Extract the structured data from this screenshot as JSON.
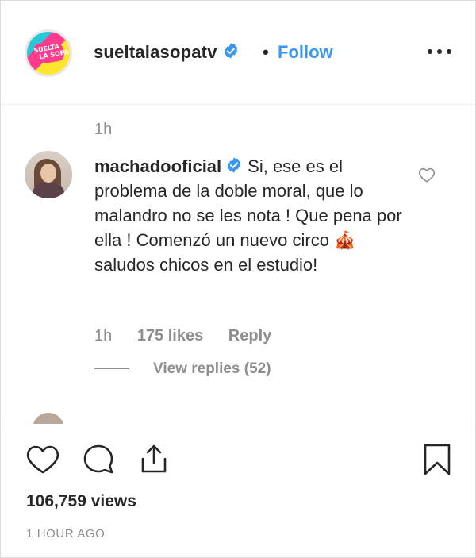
{
  "post": {
    "username": "sueltalasopatv",
    "separator": "•",
    "follow_label": "Follow",
    "avatar_logo_text": "SUELTA\n  LA SOPA!",
    "more_icon": "more-options-icon"
  },
  "comment": {
    "top_timestamp": "1h",
    "username": "machadooficial",
    "text_before_emoji": "Si, ese es el problema de la doble moral, que lo malandro no se les nota ! Que pena por ella ! Comenzó un nuevo circo ",
    "emoji": "🎪",
    "text_after_emoji": " saludos chicos en el estudio!",
    "time": "1h",
    "likes": "175 likes",
    "reply_label": "Reply",
    "view_replies": "View replies (52)"
  },
  "actions": {
    "icons": [
      "heart-icon",
      "comment-icon",
      "share-icon",
      "bookmark-icon"
    ],
    "views": "106,759 views",
    "posted_ago": "1 HOUR AGO"
  },
  "colors": {
    "follow_blue": "#3897f0",
    "verified_blue": "#3897f0",
    "muted_gray": "#8e8e8e",
    "text": "#262626"
  }
}
